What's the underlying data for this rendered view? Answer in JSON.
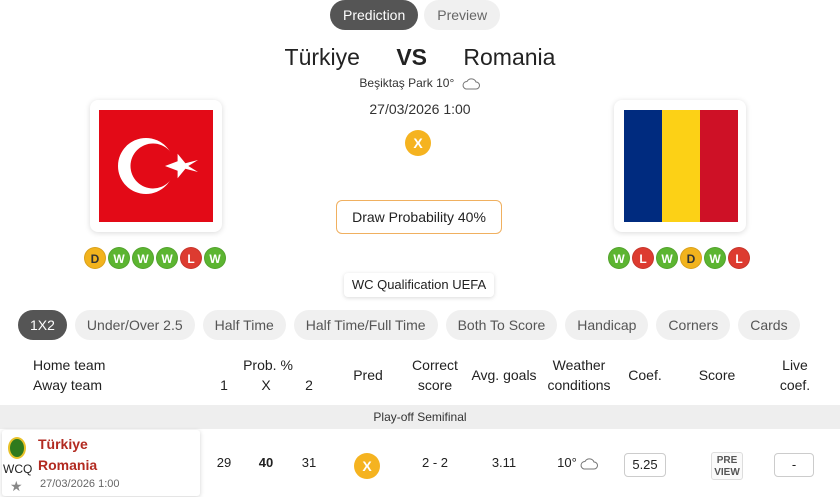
{
  "top_tabs": [
    {
      "label": "Prediction",
      "active": true
    },
    {
      "label": "Preview",
      "active": false
    }
  ],
  "match": {
    "home": "Türkiye",
    "vs": "VS",
    "away": "Romania",
    "venue": "Beşiktaş Park 10°",
    "weather_icon": "cloud-icon",
    "datetime": "27/03/2026 1:00",
    "prediction": "X",
    "draw_probability": "Draw Probability 40%",
    "competition": "WC Qualification UEFA"
  },
  "form": {
    "home": [
      "D",
      "W",
      "W",
      "W",
      "L",
      "W"
    ],
    "away": [
      "W",
      "L",
      "W",
      "D",
      "W",
      "L"
    ]
  },
  "colors": {
    "win": "#5cb531",
    "loss": "#dd3b30",
    "draw": "#f2b31d",
    "prediction_accent": "#f5b320",
    "team_name": "#b22a20",
    "turkey_red": "#e30a17",
    "romania_blue": "#002b7f",
    "romania_yellow": "#fcd116",
    "romania_red": "#ce1126"
  },
  "market_tabs": [
    {
      "label": "1X2",
      "active": true
    },
    {
      "label": "Under/Over 2.5",
      "active": false
    },
    {
      "label": "Half Time",
      "active": false
    },
    {
      "label": "Half Time/Full Time",
      "active": false
    },
    {
      "label": "Both To Score",
      "active": false
    },
    {
      "label": "Handicap",
      "active": false
    },
    {
      "label": "Corners",
      "active": false
    },
    {
      "label": "Cards",
      "active": false
    }
  ],
  "table_header": {
    "home_team": "Home team",
    "away_team": "Away team",
    "prob": "Prob. %",
    "p1": "1",
    "px": "X",
    "p2": "2",
    "pred": "Pred",
    "correct_score_1": "Correct",
    "correct_score_2": "score",
    "avg_goals": "Avg. goals",
    "weather_1": "Weather",
    "weather_2": "conditions",
    "coef": "Coef.",
    "score": "Score",
    "live_coef_1": "Live",
    "live_coef_2": "coef."
  },
  "section": "Play-off Semifinal",
  "row": {
    "competition_code": "WCQ",
    "home": "Türkiye",
    "away": "Romania",
    "date": "27/03/2026 1:00",
    "prob_1": "29",
    "prob_x": "40",
    "prob_2": "31",
    "pred": "X",
    "correct_score": "2 - 2",
    "avg_goals": "3.11",
    "weather": "10°",
    "coef": "5.25",
    "preview_1": "PRE",
    "preview_2": "VIEW",
    "live_coef": "-"
  }
}
